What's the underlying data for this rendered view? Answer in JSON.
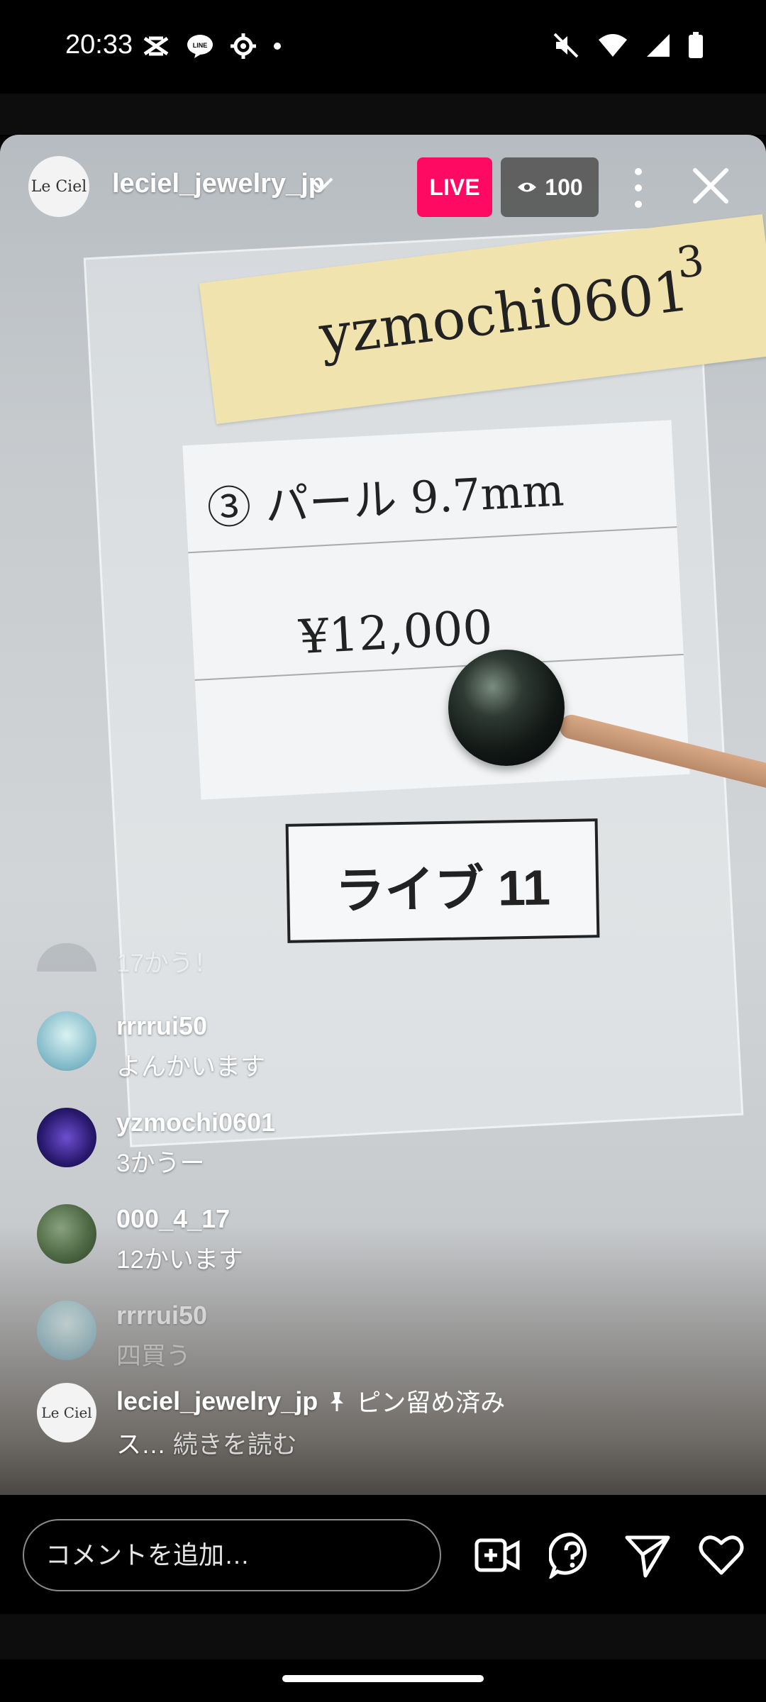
{
  "status_bar": {
    "time": "20:33",
    "left_icons": [
      "capcut-icon",
      "line-icon",
      "settings-icon",
      "dot-icon"
    ],
    "right_icons": [
      "mute-icon",
      "wifi-icon",
      "signal-icon",
      "battery-icon"
    ]
  },
  "scene": {
    "label_text": "yzmochi0601",
    "label_number": "3",
    "card_line1": "③ パール 9.7mm",
    "card_line2": "¥12,000",
    "live_sign": "ライブ 11"
  },
  "header": {
    "avatar_text": "Le Ciel",
    "host_username": "leciel_jewelry_jp",
    "live_label": "LIVE",
    "viewer_count": "100"
  },
  "comments": [
    {
      "username": "",
      "text": "17かう！",
      "faded": true
    },
    {
      "username": "rrrrui50",
      "text": "よんかいます"
    },
    {
      "username": "yzmochi0601",
      "text": "3かうー"
    },
    {
      "username": "000_4_17",
      "text": "12かいます"
    },
    {
      "username": "rrrrui50",
      "text": "四買う",
      "faded": true
    }
  ],
  "pinned": {
    "username": "leciel_jewelry_jp",
    "pinned_label": "ピン留め済み",
    "text": "ス…",
    "read_more": "続きを読む",
    "avatar_text": "Le Ciel"
  },
  "bottom_bar": {
    "comment_placeholder": "コメントを追加…",
    "icons": [
      "add-video-icon",
      "question-icon",
      "send-icon",
      "heart-icon"
    ]
  },
  "colors": {
    "live_badge": "#ff0a63",
    "background": "#000000"
  }
}
